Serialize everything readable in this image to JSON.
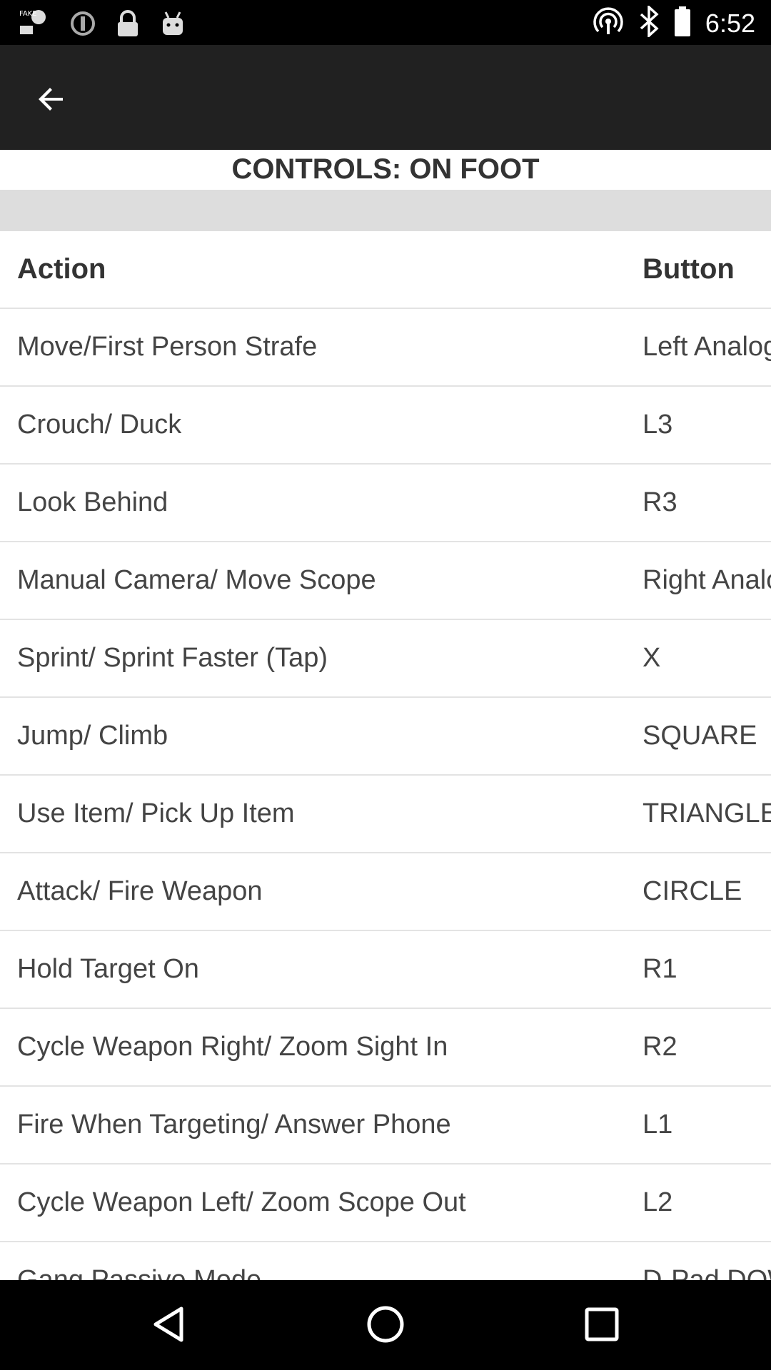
{
  "status_bar": {
    "time": "6:52",
    "icons_left": [
      "fake-gps-icon",
      "sync-icon",
      "lock-icon",
      "android-icon"
    ],
    "icons_right": [
      "hotspot-icon",
      "bluetooth-icon",
      "battery-icon"
    ]
  },
  "app_bar": {
    "back_icon": "arrow-back-icon"
  },
  "page": {
    "title": "CONTROLS: ON FOOT"
  },
  "table": {
    "headers": {
      "action": "Action",
      "button": "Button"
    },
    "rows": [
      {
        "action": "Move/First Person Strafe",
        "button": "Left Analog Stick"
      },
      {
        "action": "Crouch/ Duck",
        "button": "L3"
      },
      {
        "action": "Look Behind",
        "button": "R3"
      },
      {
        "action": "Manual Camera/ Move Scope",
        "button": "Right Analog Stick"
      },
      {
        "action": "Sprint/ Sprint Faster (Tap)",
        "button": "X"
      },
      {
        "action": "Jump/ Climb",
        "button": "SQUARE"
      },
      {
        "action": "Use Item/ Pick Up Item",
        "button": "TRIANGLE"
      },
      {
        "action": "Attack/ Fire Weapon",
        "button": "CIRCLE"
      },
      {
        "action": "Hold Target On",
        "button": "R1"
      },
      {
        "action": "Cycle Weapon Right/ Zoom Sight In",
        "button": "R2"
      },
      {
        "action": "Fire When Targeting/ Answer Phone",
        "button": "L1"
      },
      {
        "action": "Cycle Weapon Left/ Zoom Scope Out",
        "button": "L2"
      },
      {
        "action": "Gang Passive Mode",
        "button": "D-Pad DOWN"
      }
    ]
  },
  "nav_bar": {
    "icons": [
      "back-triangle-icon",
      "home-circle-icon",
      "recents-square-icon"
    ]
  }
}
